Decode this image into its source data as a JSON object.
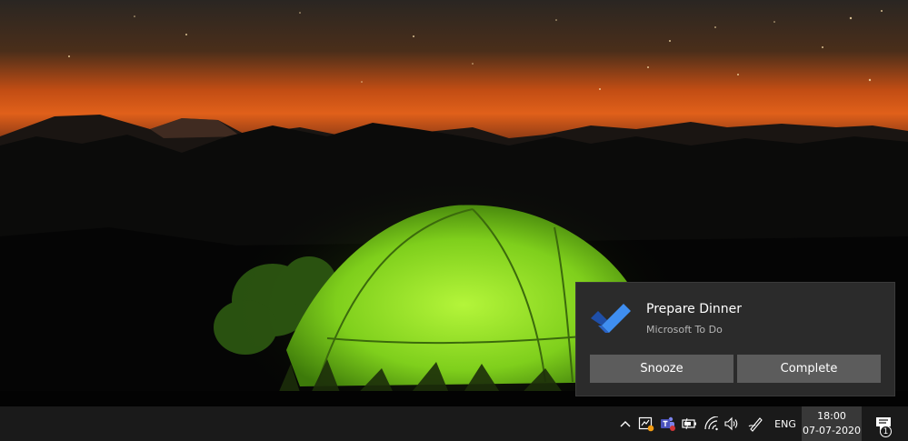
{
  "notification": {
    "title": "Prepare Dinner",
    "app_name": "Microsoft To Do",
    "app_icon": "microsoft-todo-checkmark-icon",
    "buttons": [
      {
        "label": "Snooze"
      },
      {
        "label": "Complete"
      }
    ]
  },
  "taskbar": {
    "tray_icons": [
      "show-hidden-icons-chevron-icon",
      "security-alert-icon",
      "microsoft-teams-icon",
      "battery-icon",
      "wifi-icon",
      "volume-icon",
      "pen-workspace-icon"
    ],
    "language": "ENG",
    "clock": {
      "time": "18:00",
      "date": "07-07-2020"
    },
    "action_center": {
      "icon": "action-center-icon",
      "count": "1"
    }
  },
  "colors": {
    "toast_bg": "#2b2b2b",
    "button_bg": "#5c5c5c",
    "taskbar_bg": "#1a1a1a",
    "clock_highlight": "#383838",
    "todo_blue": "#2564cf"
  }
}
